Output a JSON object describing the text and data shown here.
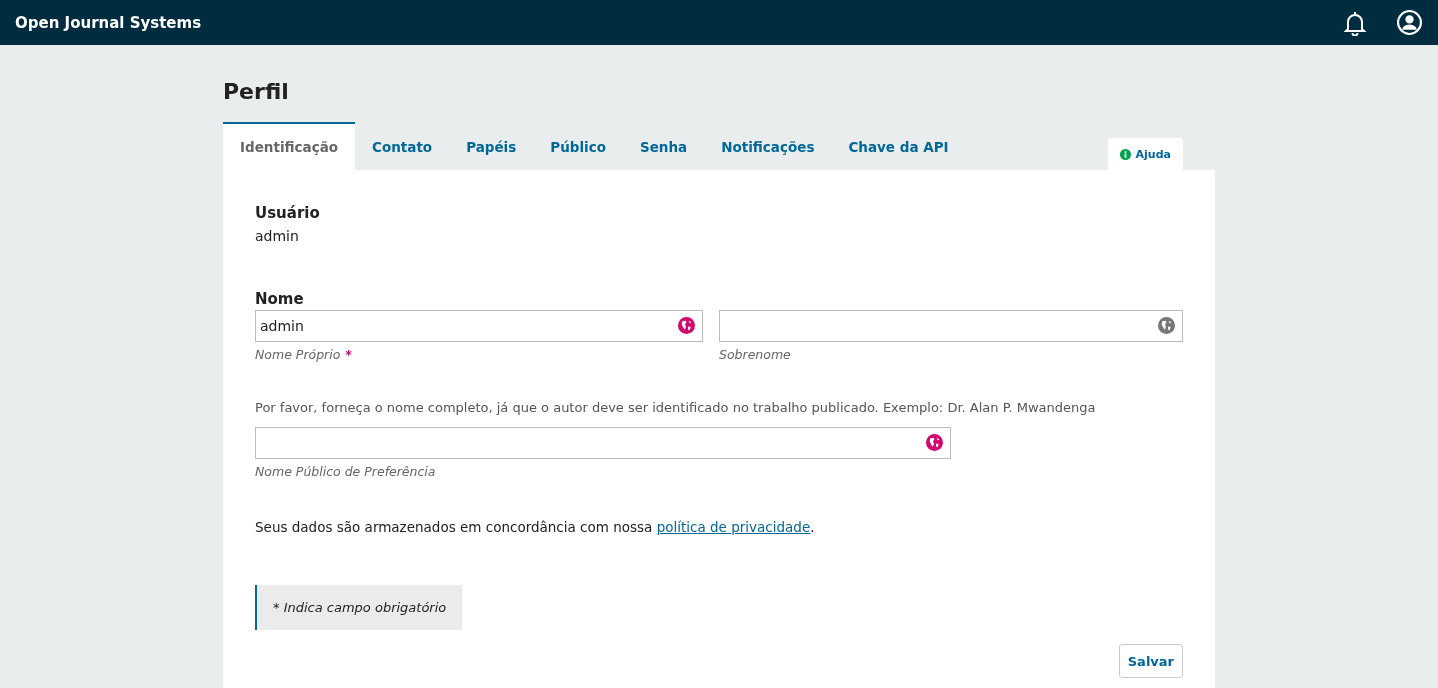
{
  "header": {
    "title": "Open Journal Systems"
  },
  "page_title": "Perfil",
  "tabs": [
    {
      "label": "Identificação",
      "selected": true
    },
    {
      "label": "Contato",
      "selected": false
    },
    {
      "label": "Papéis",
      "selected": false
    },
    {
      "label": "Público",
      "selected": false
    },
    {
      "label": "Senha",
      "selected": false
    },
    {
      "label": "Notificações",
      "selected": false
    },
    {
      "label": "Chave da API",
      "selected": false
    }
  ],
  "help": {
    "label": "Ajuda"
  },
  "username": {
    "label": "Usuário",
    "value": "admin"
  },
  "name": {
    "label": "Nome",
    "fields": [
      {
        "value": "admin",
        "caption": "Nome Próprio",
        "required": true,
        "color": "#d00a6c"
      },
      {
        "caption": "Sobrenome",
        "required": false,
        "color": "#777777"
      }
    ]
  },
  "hint": "Por favor, forneça o nome completo, já que o autor deve ser identificado no trabalho publicado. Exemplo: Dr. Alan P. Mwandenga",
  "preferred": {
    "caption": "Nome Público de Preferência",
    "color": "#d00a6c"
  },
  "privacy": {
    "text": "Seus dados são armazenados em concordância com nossa ",
    "link": "política de privacidade",
    "end": "."
  },
  "required_note": "* Indica campo obrigatório",
  "required_mark": "*",
  "save_button": "Salvar"
}
